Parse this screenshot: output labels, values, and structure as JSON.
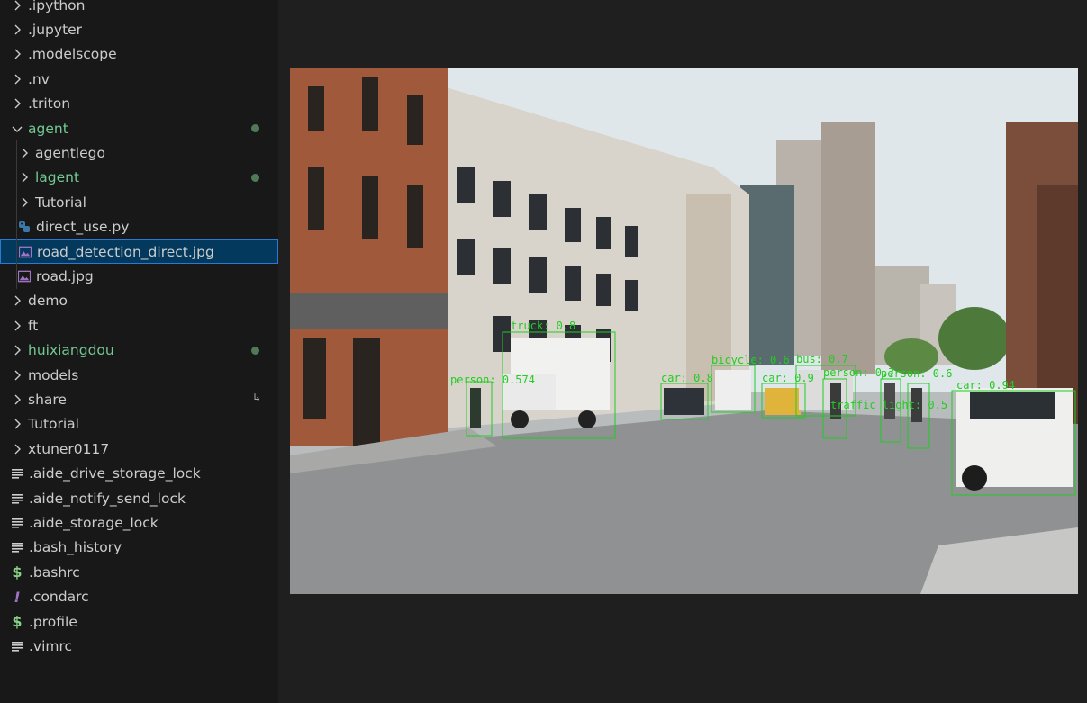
{
  "explorer": {
    "items": [
      {
        "label": ".ipython",
        "type": "folder",
        "depth": 0,
        "expanded": false
      },
      {
        "label": ".jupyter",
        "type": "folder",
        "depth": 0,
        "expanded": false
      },
      {
        "label": ".modelscope",
        "type": "folder",
        "depth": 0,
        "expanded": false
      },
      {
        "label": ".nv",
        "type": "folder",
        "depth": 0,
        "expanded": false
      },
      {
        "label": ".triton",
        "type": "folder",
        "depth": 0,
        "expanded": false
      },
      {
        "label": "agent",
        "type": "folder",
        "depth": 0,
        "expanded": true,
        "modified": true
      },
      {
        "label": "agentlego",
        "type": "folder",
        "depth": 1,
        "expanded": false
      },
      {
        "label": "lagent",
        "type": "folder",
        "depth": 1,
        "expanded": false,
        "modified": true
      },
      {
        "label": "Tutorial",
        "type": "folder",
        "depth": 1,
        "expanded": false
      },
      {
        "label": "direct_use.py",
        "type": "python",
        "depth": 1
      },
      {
        "label": "road_detection_direct.jpg",
        "type": "image",
        "depth": 1,
        "selected": true
      },
      {
        "label": "road.jpg",
        "type": "image",
        "depth": 1
      },
      {
        "label": "demo",
        "type": "folder",
        "depth": 0,
        "expanded": false
      },
      {
        "label": "ft",
        "type": "folder",
        "depth": 0,
        "expanded": false
      },
      {
        "label": "huixiangdou",
        "type": "folder",
        "depth": 0,
        "expanded": false,
        "modified": true
      },
      {
        "label": "models",
        "type": "folder",
        "depth": 0,
        "expanded": false
      },
      {
        "label": "share",
        "type": "folder",
        "depth": 0,
        "expanded": false,
        "symlink": true
      },
      {
        "label": "Tutorial",
        "type": "folder",
        "depth": 0,
        "expanded": false
      },
      {
        "label": "xtuner0117",
        "type": "folder",
        "depth": 0,
        "expanded": false
      },
      {
        "label": ".aide_drive_storage_lock",
        "type": "text",
        "depth": 0
      },
      {
        "label": ".aide_notify_send_lock",
        "type": "text",
        "depth": 0
      },
      {
        "label": ".aide_storage_lock",
        "type": "text",
        "depth": 0
      },
      {
        "label": ".bash_history",
        "type": "text",
        "depth": 0
      },
      {
        "label": ".bashrc",
        "type": "shell",
        "depth": 0
      },
      {
        "label": ".condarc",
        "type": "config",
        "depth": 0
      },
      {
        "label": ".profile",
        "type": "shell",
        "depth": 0
      },
      {
        "label": ".vimrc",
        "type": "text",
        "depth": 0
      }
    ]
  },
  "detection_labels": [
    "person: 0.574",
    "truck: 0.8",
    "car: 0.8",
    "bicycle: 0.6",
    "person: 0.7",
    "person: 0.6",
    "bus: 0.7",
    "car: 0.94",
    "car: 0.9",
    "traffic light: 0.5"
  ],
  "colors": {
    "modified": "#73c991",
    "selected_bg": "#04395e",
    "selected_border": "#2b79d4",
    "detection_box": "#22cc22",
    "text": "#cccccc"
  },
  "icons": {
    "python": "python-icon",
    "image": "image-file-icon",
    "text": "text-file-icon",
    "shell": "dollar-icon",
    "config": "exclamation-icon"
  }
}
